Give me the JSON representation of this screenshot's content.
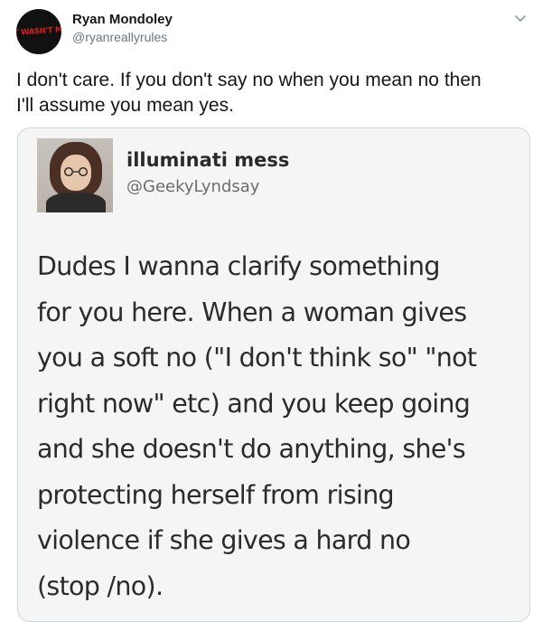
{
  "tweet": {
    "avatar_text": "IT WASN'T ME",
    "display_name": "Ryan Mondoley",
    "handle": "@ryanreallyrules",
    "text_lines": [
      "I don't care. If you don't say no when you mean no then",
      "I'll assume you mean yes."
    ],
    "menu_icon": "chevron-down-icon"
  },
  "quoted": {
    "display_name": "illuminati mess",
    "handle": "@GeekyLyndsay",
    "body_lines": [
      "Dudes I wanna clarify something",
      "for you here. When a woman gives",
      "you a soft no (\"I don't think so\" \"not",
      "right now\" etc) and you keep going",
      "and she doesn't do anything, she's",
      "protecting herself from rising",
      "violence if she gives a hard no",
      "(stop /no)."
    ]
  },
  "colors": {
    "name": "#14171a",
    "secondary": "#657786",
    "card_border": "#ccd6dd",
    "avatar_text": "#d81e1e"
  }
}
